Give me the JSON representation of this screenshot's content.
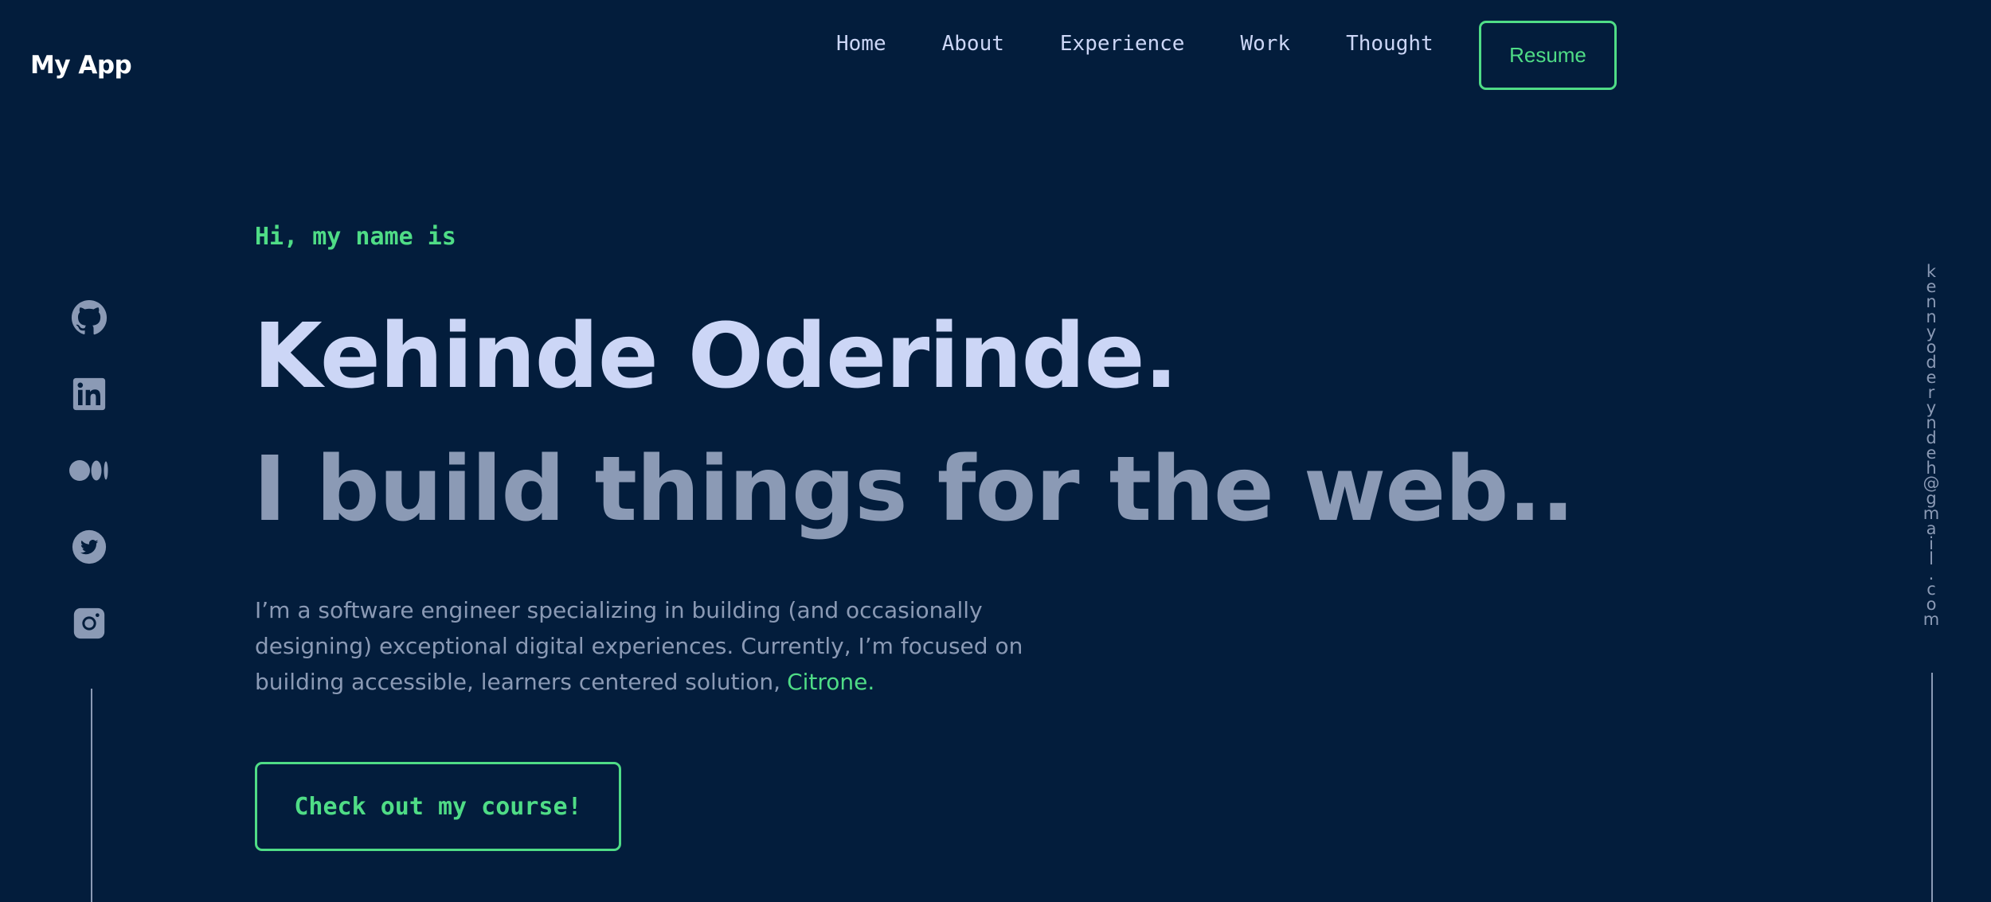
{
  "app": {
    "title": "My App"
  },
  "nav": {
    "items": [
      {
        "label": "Home"
      },
      {
        "label": "About"
      },
      {
        "label": "Experience"
      },
      {
        "label": "Work"
      },
      {
        "label": "Thought"
      }
    ],
    "resume_label": "Resume"
  },
  "social": {
    "icons": [
      "github-icon",
      "linkedin-icon",
      "medium-icon",
      "twitter-icon",
      "instagram-icon"
    ],
    "icon_color": "#8b9ab5"
  },
  "email": {
    "address": "kennyoderyndeh@gmail.com"
  },
  "hero": {
    "greeting": "Hi, my name is",
    "name": "Kehinde Oderinde.",
    "tagline": "I build things for the web..",
    "intro": "I’m a software engineer specializing in building (and occasionally designing) exceptional digital experiences. Currently, I’m focused on building accessible, learners centered solution,",
    "highlight": "Citrone.",
    "cta_label": "Check out my course!"
  },
  "colors": {
    "background": "#031d3c",
    "accent": "#4fdc86",
    "heading": "#ccd6f6",
    "muted": "#8b9ab5"
  }
}
